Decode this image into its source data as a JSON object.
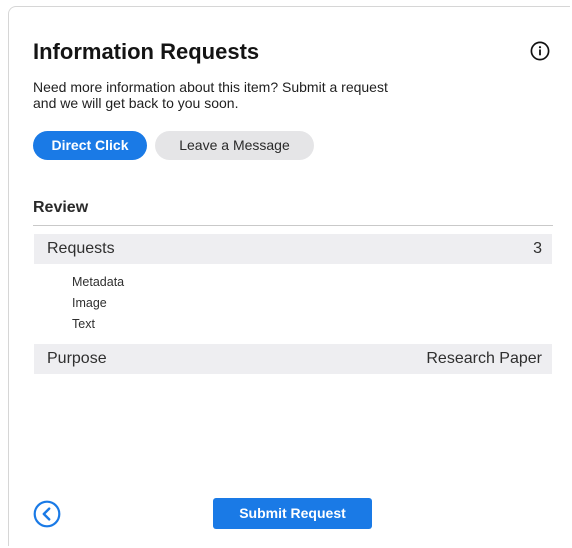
{
  "header": {
    "title": "Information Requests",
    "subtitle_line1": "Need more information about this item? Submit a request",
    "subtitle_line2": "and we will get back to you soon.",
    "info_icon": "info-icon"
  },
  "tabs": [
    {
      "label": "Direct Click",
      "active": true
    },
    {
      "label": "Leave a Message",
      "active": false
    }
  ],
  "review": {
    "heading": "Review",
    "requests": {
      "label": "Requests",
      "count": "3",
      "items": [
        "Metadata",
        "Image",
        "Text"
      ]
    },
    "purpose": {
      "label": "Purpose",
      "value": "Research Paper"
    }
  },
  "footer": {
    "back_icon": "chevron-left-circle-icon",
    "submit_label": "Submit Request"
  },
  "colors": {
    "accent": "#1a7ae6",
    "inactive_tab": "#e5e5e7",
    "row_band": "#eeeef1"
  }
}
